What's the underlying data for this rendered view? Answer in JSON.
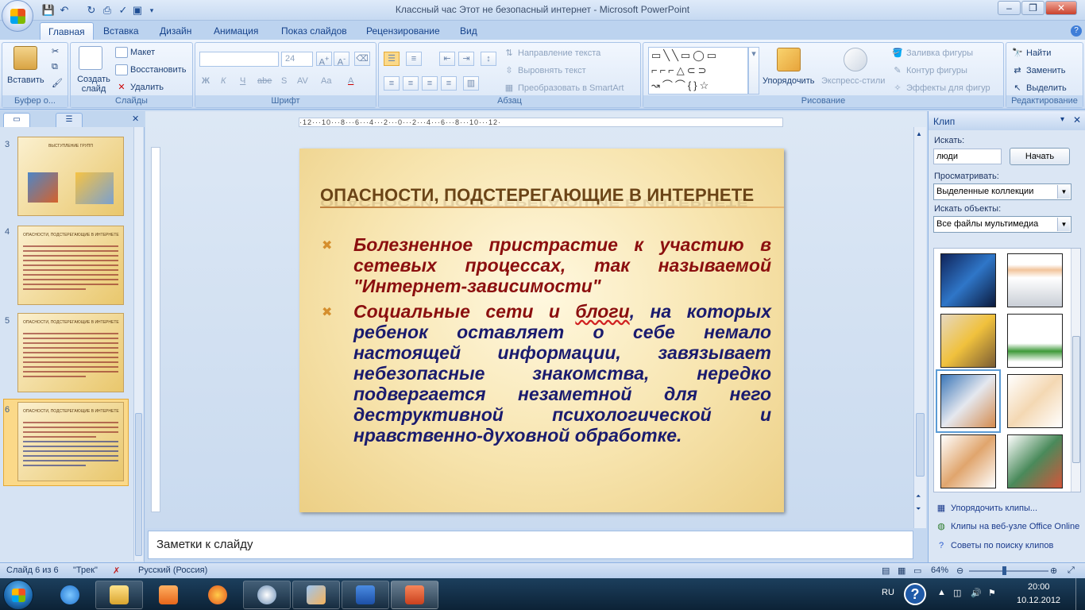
{
  "window": {
    "title": "Классный час Этот не безопасный интернет - Microsoft PowerPoint"
  },
  "tabs": [
    "Главная",
    "Вставка",
    "Дизайн",
    "Анимация",
    "Показ слайдов",
    "Рецензирование",
    "Вид"
  ],
  "active_tab": "Главная",
  "ribbon": {
    "clipboard": {
      "paste": "Вставить",
      "label": "Буфер о..."
    },
    "slides": {
      "new_slide": "Создать слайд",
      "layout": "Макет",
      "reset": "Восстановить",
      "delete": "Удалить",
      "label": "Слайды"
    },
    "font": {
      "size": "24",
      "bold": "Ж",
      "italic": "К",
      "underline": "Ч",
      "strike": "abe",
      "shadow": "S",
      "spacing": "AV",
      "case": "Aa",
      "color": "A",
      "label": "Шрифт"
    },
    "paragraph": {
      "text_direction": "Направление текста",
      "align_text": "Выровнять текст",
      "smartart": "Преобразовать в SmartArt",
      "label": "Абзац"
    },
    "drawing": {
      "arrange": "Упорядочить",
      "quick_styles": "Экспресс-стили",
      "shape_fill": "Заливка фигуры",
      "shape_outline": "Контур фигуры",
      "shape_effects": "Эффекты для фигур",
      "label": "Рисование"
    },
    "editing": {
      "find": "Найти",
      "replace": "Заменить",
      "select": "Выделить",
      "label": "Редактирование"
    }
  },
  "thumbnails": [
    {
      "num": "3",
      "title": "ВЫСТУПЛЕНИЕ ГРУПП"
    },
    {
      "num": "4",
      "title": "ОПАСНОСТИ, ПОДСТЕРЕГАЮЩИЕ В ИНТЕРНЕТЕ"
    },
    {
      "num": "5",
      "title": "ОПАСНОСТИ, ПОДСТЕРЕГАЮЩИЕ В ИНТЕРНЕТЕ"
    },
    {
      "num": "6",
      "title": "ОПАСНОСТИ, ПОДСТЕРЕГАЮЩИЕ В ИНТЕРНЕТЕ"
    }
  ],
  "ruler": {
    "horizontal": "·12···10···8···6···4···2···0···2···4···6···8···10···12·"
  },
  "slide": {
    "title": "ОПАСНОСТИ, ПОДСТЕРЕГАЮЩИЕ В ИНТЕРНЕТЕ",
    "bullet1": "Болезненное пристрастие к участию в сетевых процессах, так называемой \"Интернет-зависимости\"",
    "bullet2_a": "Социальные сети и ",
    "bullet2_b": "блоги",
    "bullet2_c": ", на которых ребенок оставляет о себе немало настоящей информации, завязывает небезопасные знакомства, нередко подвергается незаметной для него деструктивной психологической и нравственно-духовной обработке."
  },
  "notes": {
    "placeholder": "Заметки к слайду"
  },
  "clip": {
    "title": "Клип",
    "search_label": "Искать:",
    "search_value": "люди",
    "start_button": "Начать",
    "browse_label": "Просматривать:",
    "browse_value": "Выделенные коллекции",
    "find_objects_label": "Искать объекты:",
    "find_objects_value": "Все файлы мультимедиа",
    "links": [
      "Упорядочить клипы...",
      "Клипы на веб-узле Office Online",
      "Советы по поиску клипов"
    ]
  },
  "status": {
    "slide": "Слайд 6 из 6",
    "theme": "\"Трек\"",
    "language": "Русский (Россия)",
    "zoom": "64%"
  },
  "tray": {
    "lang": "RU",
    "time": "20:00",
    "date": "10.12.2012"
  },
  "colors": {
    "title_brown": "#6b4417",
    "bullet1": "#8b0f0f",
    "bullet2": "#1a1b6e",
    "accent": "#d58f2e"
  }
}
